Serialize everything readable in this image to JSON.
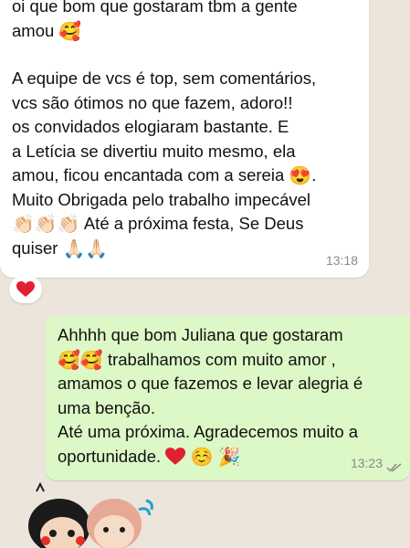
{
  "incoming": {
    "lines": [
      "oi que bom que gostaram tbm a gente",
      "amou",
      "A equipe de vcs é top, sem comentários,",
      "vcs são ótimos no que fazem, adoro!!",
      "os convidados elogiaram bastante. E",
      "a Letícia se divertiu muito mesmo,  ela",
      "amou, ficou encantada com a sereia",
      "Muito Obrigada pelo trabalho impecável",
      "Até a próxima festa, Se Deus",
      "quiser"
    ],
    "time": "13:18",
    "reaction": "red-heart"
  },
  "outgoing": {
    "lines": [
      "Ahhhh que bom Juliana que gostaram",
      "trabalhamos com muito amor ,",
      "amamos o que fazemos e levar alegria é",
      "uma benção.",
      "Até uma próxima. Agradecemos muito a",
      "oportunidade."
    ],
    "time": "13:23",
    "status": "read-double-check"
  },
  "icons": {
    "heart_face": "smiling-face-with-hearts-emoji",
    "heart_eyes": "heart-eyes-emoji",
    "clap": "clapping-hands-emoji",
    "pray": "folded-hands-emoji",
    "red_heart": "red-heart-emoji",
    "smile": "smiling-face-emoji",
    "party": "party-popper-emoji"
  },
  "colors": {
    "incoming_bubble": "#ffffff",
    "outgoing_bubble": "#dcf8c6",
    "wallpaper": "#ece5dc",
    "time_text": "#8a8a8a",
    "ticks": "#8a8a8a"
  }
}
